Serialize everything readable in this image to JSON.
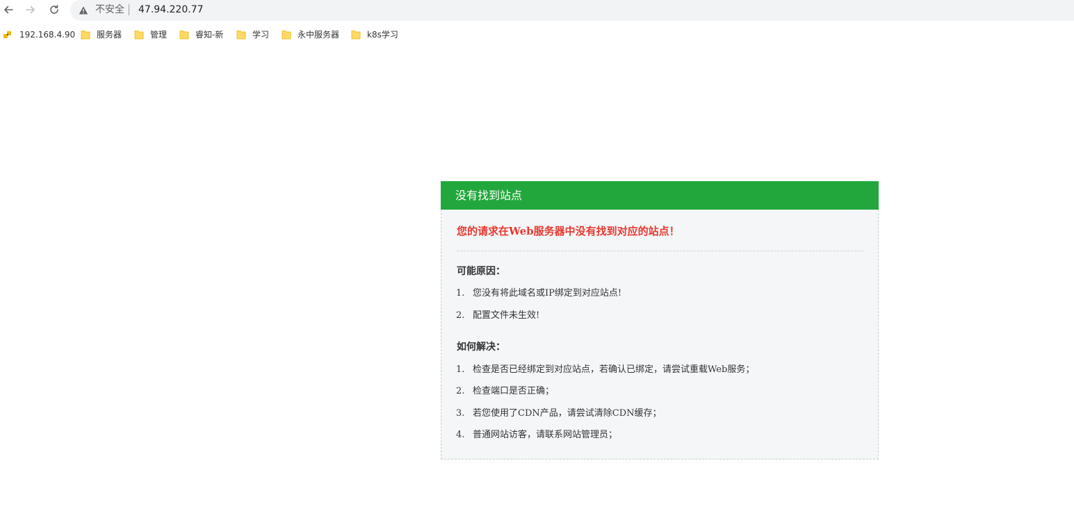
{
  "browser": {
    "security_label": "不安全",
    "url": "47.94.220.77",
    "bookmarks": [
      {
        "label": "192.168.4.90",
        "icon": "site-icon"
      },
      {
        "label": "服务器",
        "icon": "folder-icon"
      },
      {
        "label": "管理",
        "icon": "folder-icon"
      },
      {
        "label": "睿知-新",
        "icon": "folder-icon"
      },
      {
        "label": "学习",
        "icon": "folder-icon"
      },
      {
        "label": "永中服务器",
        "icon": "folder-icon"
      },
      {
        "label": "k8s学习",
        "icon": "folder-icon"
      }
    ]
  },
  "colors": {
    "header_green": "#22a73c",
    "headline_red": "#e8372e",
    "body_bg": "#f4f6f8"
  },
  "error_page": {
    "header": "没有找到站点",
    "headline": "您的请求在Web服务器中没有找到对应的站点！",
    "reasons": {
      "title": "可能原因：",
      "items": [
        {
          "num": "1.",
          "text": "您没有将此域名或IP绑定到对应站点!"
        },
        {
          "num": "2.",
          "text": "配置文件未生效!"
        }
      ]
    },
    "solutions": {
      "title": "如何解决：",
      "items": [
        {
          "num": "1.",
          "text": "检查是否已经绑定到对应站点，若确认已绑定，请尝试重载Web服务；"
        },
        {
          "num": "2.",
          "text": "检查端口是否正确；"
        },
        {
          "num": "3.",
          "text": "若您使用了CDN产品，请尝试清除CDN缓存；"
        },
        {
          "num": "4.",
          "text": "普通网站访客，请联系网站管理员；"
        }
      ]
    }
  }
}
